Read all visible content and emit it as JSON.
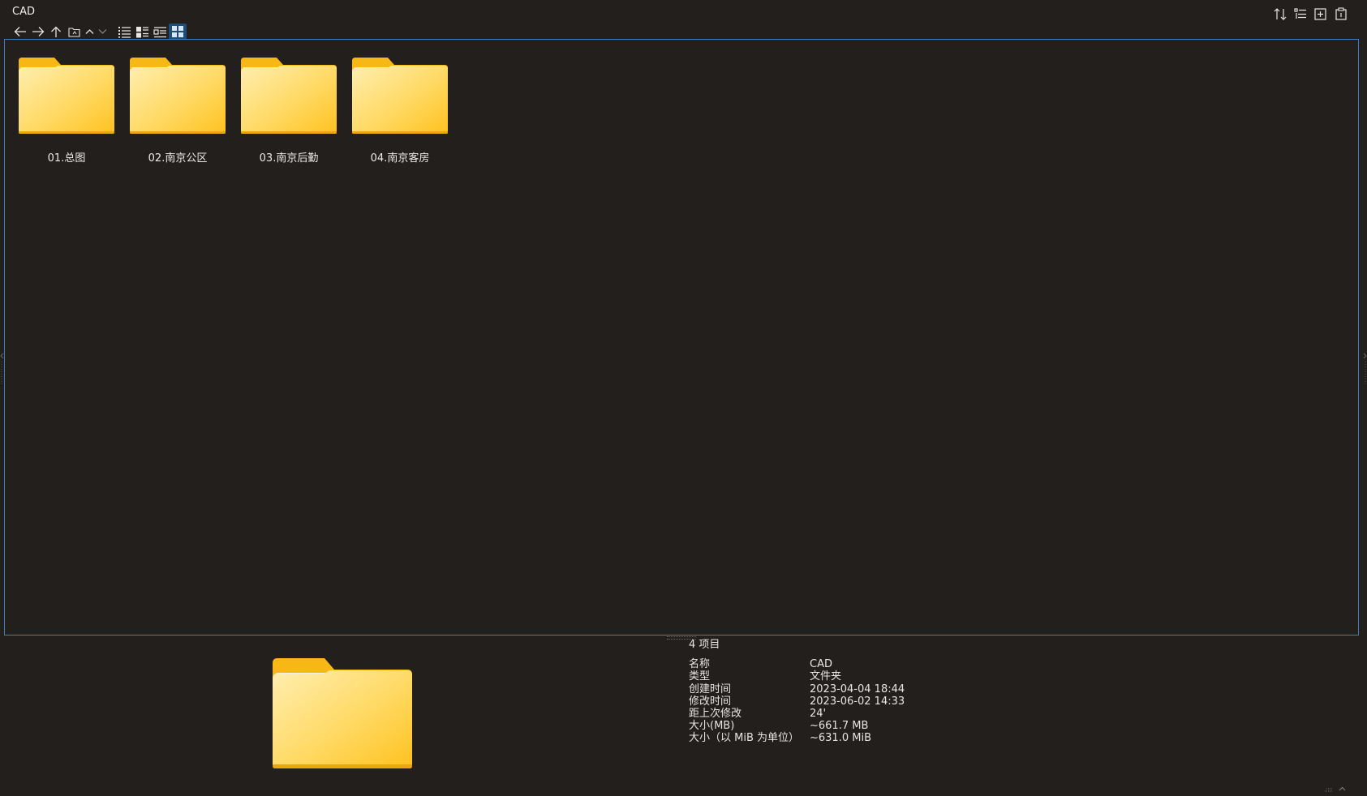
{
  "window": {
    "title": "CAD"
  },
  "toolbar": {
    "buttons": [
      {
        "name": "back",
        "icon": "arrow-left-icon"
      },
      {
        "name": "forward",
        "icon": "arrow-right-icon"
      },
      {
        "name": "up",
        "icon": "arrow-up-icon"
      },
      {
        "name": "folder-location",
        "icon": "folder-location-icon"
      },
      {
        "name": "collapse",
        "icon": "chevron-up-icon"
      },
      {
        "name": "expand",
        "icon": "chevron-down-icon"
      },
      {
        "name": "view-details",
        "icon": "details-view-icon"
      },
      {
        "name": "view-tiles",
        "icon": "tiles-view-icon"
      },
      {
        "name": "view-content",
        "icon": "content-view-icon"
      },
      {
        "name": "view-large-icons",
        "icon": "large-icons-view-icon",
        "active": true
      }
    ],
    "right_buttons": [
      {
        "name": "sort",
        "icon": "sort-icon"
      },
      {
        "name": "group",
        "icon": "group-icon"
      },
      {
        "name": "new",
        "icon": "new-item-icon"
      },
      {
        "name": "clipboard",
        "icon": "clipboard-icon"
      }
    ]
  },
  "folders": [
    {
      "name": "01.总图"
    },
    {
      "name": "02.南京公区"
    },
    {
      "name": "03.南京后勤"
    },
    {
      "name": "04.南京客房"
    }
  ],
  "details": {
    "count_label": "4 项目",
    "rows": [
      {
        "key": "名称",
        "value": "CAD"
      },
      {
        "key": "类型",
        "value": "文件夹"
      },
      {
        "key": "创建时间",
        "value": "2023-04-04  18:44"
      },
      {
        "key": "修改时间",
        "value": "2023-06-02  14:33"
      },
      {
        "key": "距上次修改",
        "value": "24'"
      },
      {
        "key": "大小(MB)",
        "value": "~661.7 MB"
      },
      {
        "key": "大小（以 MiB 为单位）",
        "value": "~631.0 MiB"
      }
    ]
  },
  "colors": {
    "background": "#221f1c",
    "selection_border": "#3a7fc1",
    "folder_front": "#ffd65c",
    "folder_back": "#f5b70f"
  }
}
